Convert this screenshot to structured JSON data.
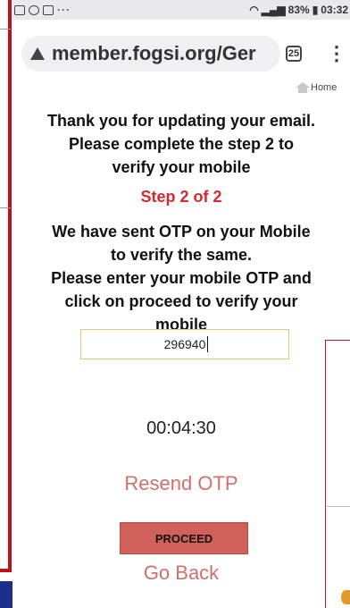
{
  "status_bar": {
    "left_dots": "···",
    "battery": "83%",
    "time": "03:32"
  },
  "browser": {
    "url": "member.fogsi.org/Ger",
    "tab_count": "25",
    "menu": "⋮"
  },
  "breadcrumb": {
    "home": "Home"
  },
  "main": {
    "heading_line1": "Thank you for updating your email.",
    "heading_line2": "Please complete the step 2 to",
    "heading_line3": "verify your mobile",
    "step": "Step 2 of 2",
    "msg_line1": "We have sent OTP on your Mobile",
    "msg_line2": "to verify the same.",
    "msg_line3": "Please enter your mobile OTP and",
    "msg_line4": "click on proceed to verify your",
    "msg_line5": "mobile",
    "otp_value": "296940",
    "timer": "00:04:30",
    "resend_label": "Resend OTP",
    "proceed_label": "PROCEED",
    "goback_label": "Go Back"
  },
  "colors": {
    "accent_red": "#d8282e",
    "link_red": "#d0706a",
    "button": "#d0605a",
    "frame_red": "#c0101a",
    "navy": "#1d2f8c"
  }
}
